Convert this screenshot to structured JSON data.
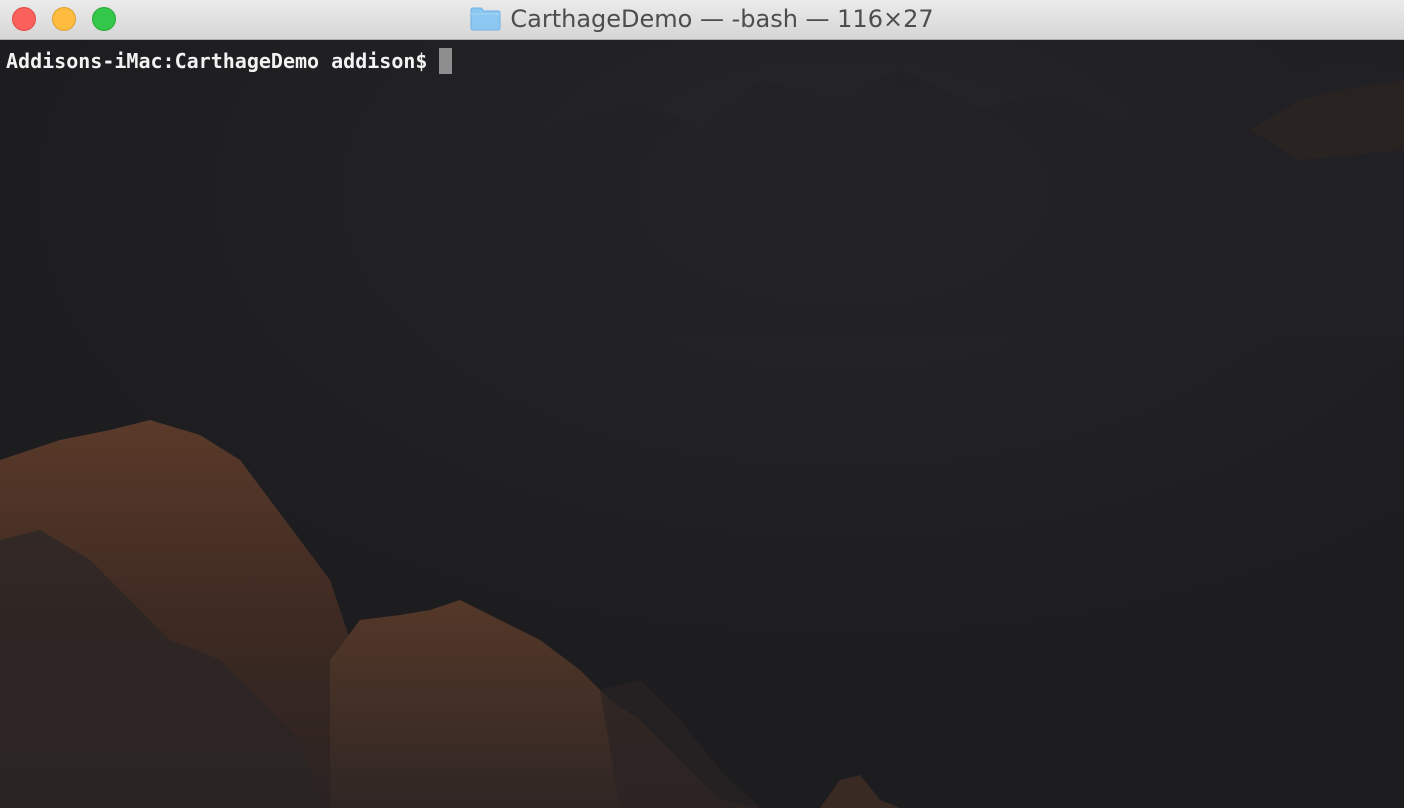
{
  "window": {
    "title": "CarthageDemo — -bash — 116×27",
    "folder_icon": "folder-icon",
    "colors": {
      "close": "#fc605c",
      "minimize": "#fdbc40",
      "zoom": "#34c84a",
      "terminal_background": "#1d1d20",
      "text": "#f2f2f2"
    }
  },
  "terminal": {
    "prompt": "Addisons-iMac:CarthageDemo addison$",
    "input": ""
  }
}
